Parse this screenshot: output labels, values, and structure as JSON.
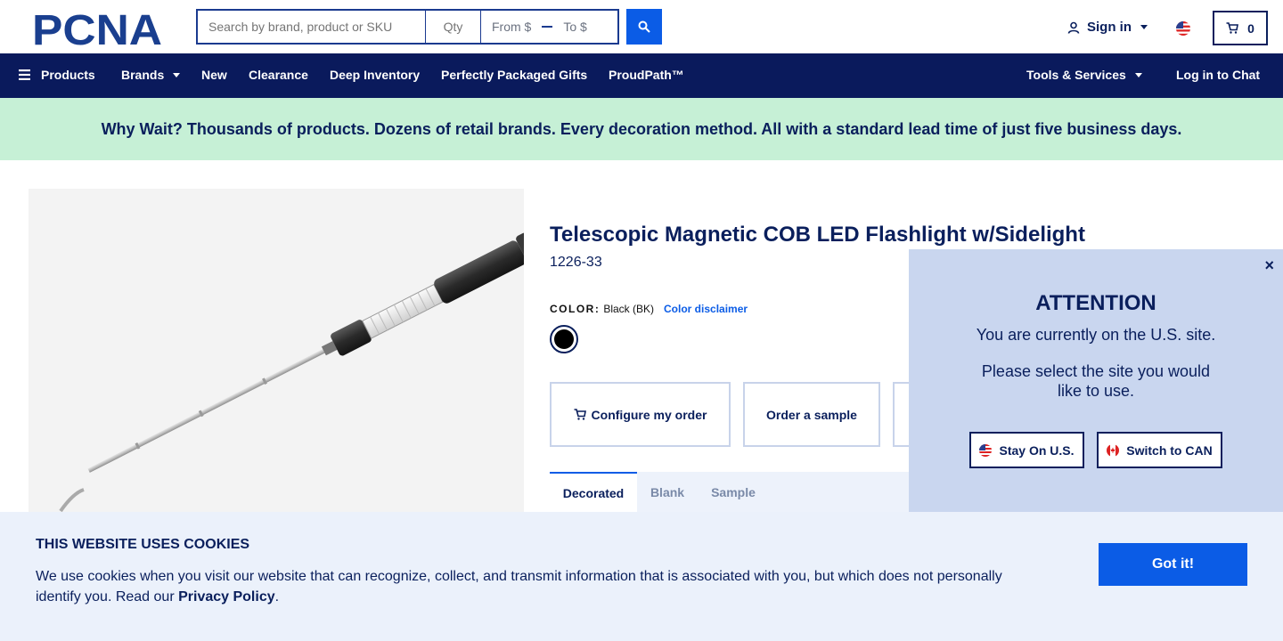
{
  "header": {
    "logo_text": "PCNA",
    "search_placeholder": "Search by brand, product or SKU",
    "qty_placeholder": "Qty",
    "price_from": "From $",
    "price_to": "To $",
    "signin_label": "Sign in",
    "cart_count": "0"
  },
  "nav": {
    "products": "Products",
    "brands": "Brands",
    "new": "New",
    "clearance": "Clearance",
    "deep_inventory": "Deep Inventory",
    "gifts": "Perfectly Packaged Gifts",
    "proudpath": "ProudPath™",
    "tools": "Tools & Services",
    "chat": "Log in to Chat"
  },
  "banner": {
    "text": "Why Wait? Thousands of products. Dozens of retail brands. Every decoration method. All with a standard lead time of just five business days."
  },
  "product": {
    "title": "Telescopic Magnetic COB LED Flashlight w/Sidelight",
    "sku": "1226-33",
    "color_label": "COLOR:",
    "color_value": "Black (BK)",
    "color_disclaimer": "Color disclaimer",
    "swatch_color": "#000000",
    "configure_label": "Configure my order",
    "sample_label": "Order a sample",
    "tabs": [
      "Decorated",
      "Blank",
      "Sample"
    ]
  },
  "attention": {
    "title": "ATTENTION",
    "line1": "You are currently on the U.S. site.",
    "line2": "Please select the site you would like to use.",
    "stay_label": "Stay On U.S.",
    "switch_label": "Switch to CAN",
    "close": "×"
  },
  "cookies": {
    "title": "THIS WEBSITE USES COOKIES",
    "text": "We use cookies when you visit our website that can recognize, collect, and transmit information that is associated with you, but which does not personally identify you. Read our",
    "privacy_link": "Privacy Policy",
    "period": ".",
    "button": "Got it!"
  },
  "colors": {
    "navy": "#0a1a5c",
    "accent": "#0b5ce6",
    "banner_green": "#c6f0d6",
    "popup_blue": "#c9d6ef"
  }
}
